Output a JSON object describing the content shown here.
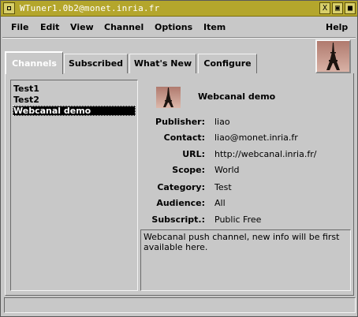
{
  "window": {
    "title": "WTuner1.0b2@monet.inria.fr",
    "buttons": {
      "close": "X",
      "maximize": "▣",
      "minimize": "■"
    }
  },
  "menu": [
    "File",
    "Edit",
    "View",
    "Channel",
    "Options",
    "Item",
    "Help"
  ],
  "tabs": [
    "Channels",
    "Subscribed",
    "What's New",
    "Configure"
  ],
  "active_tab": "Channels",
  "channels": [
    "Test1",
    "Test2",
    "Webcanal demo"
  ],
  "selected_channel": "Webcanal demo",
  "detail": {
    "name": "Webcanal demo",
    "fields": [
      {
        "label": "Publisher:",
        "value": "liao"
      },
      {
        "label": "Contact:",
        "value": "liao@monet.inria.fr"
      },
      {
        "label": "URL:",
        "value": "http://webcanal.inria.fr/"
      },
      {
        "label": "Scope:",
        "value": "World"
      },
      {
        "label": "Category:",
        "value": "Test"
      },
      {
        "label": "Audience:",
        "value": "All"
      },
      {
        "label": "Subscript.:",
        "value": "Public Free"
      }
    ],
    "description": "Webcanal push channel, new info will be first available here."
  },
  "status": "",
  "colors": {
    "titlebar": "#b4a62c",
    "background": "#c8c8c8",
    "selection": "#000000"
  },
  "icons": {
    "logo": "eiffel-tower-icon",
    "channel": "eiffel-tower-icon"
  }
}
